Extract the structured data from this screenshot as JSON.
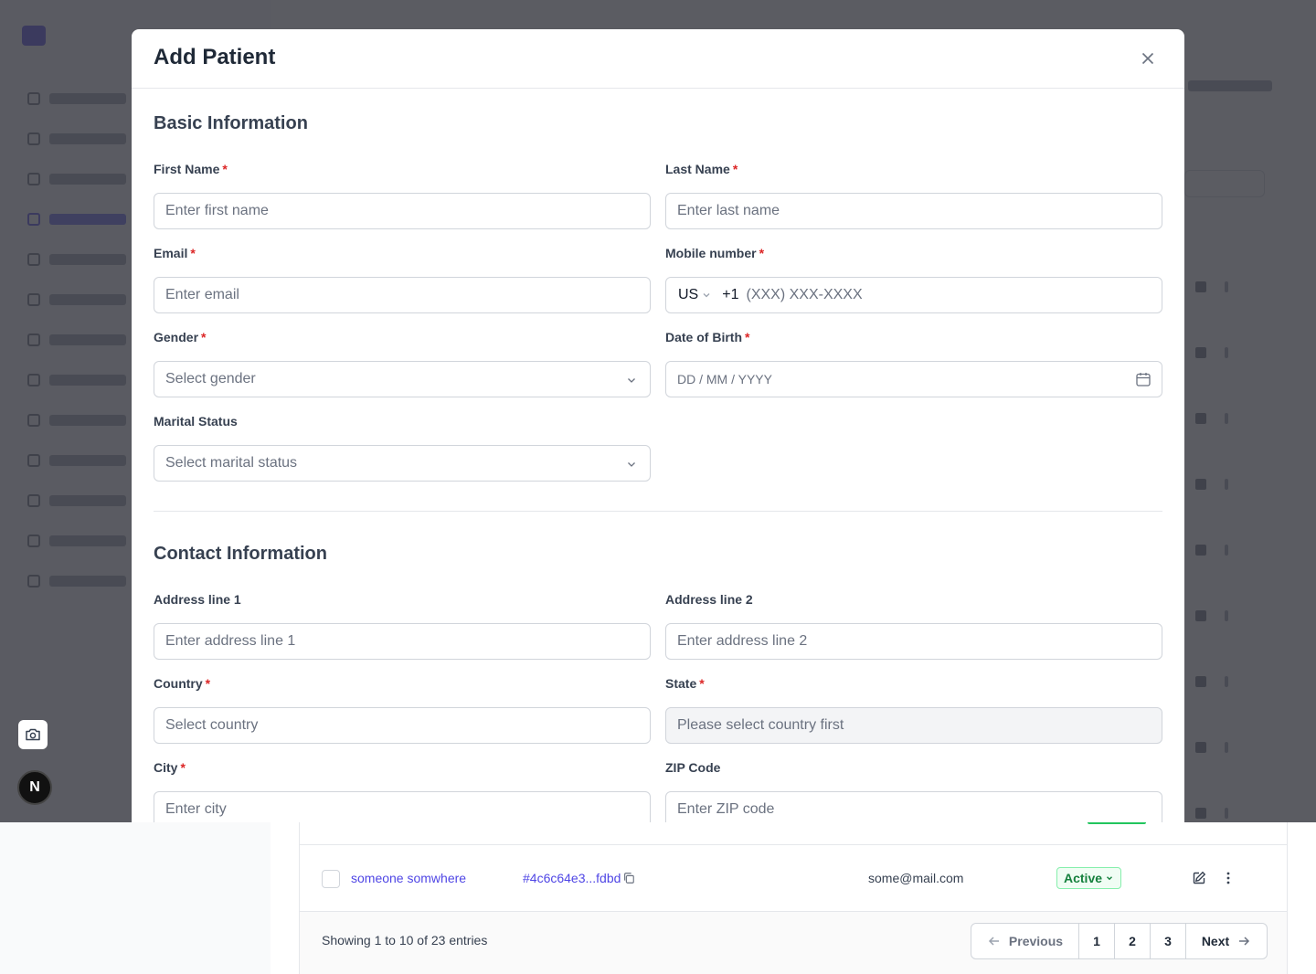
{
  "modal": {
    "title": "Add Patient",
    "sections": {
      "basic": "Basic Information",
      "contact": "Contact Information"
    },
    "fields": {
      "first_name": {
        "label": "First Name",
        "placeholder": "Enter first name",
        "required": true
      },
      "last_name": {
        "label": "Last Name",
        "placeholder": "Enter last name",
        "required": true
      },
      "email": {
        "label": "Email",
        "placeholder": "Enter email",
        "required": true
      },
      "mobile": {
        "label": "Mobile number",
        "country": "US",
        "code": "+1",
        "placeholder": "(XXX) XXX-XXXX",
        "required": true
      },
      "gender": {
        "label": "Gender",
        "placeholder": "Select gender",
        "required": true
      },
      "dob": {
        "label": "Date of Birth",
        "placeholder": "DD / MM / YYYY",
        "required": true
      },
      "marital": {
        "label": "Marital Status",
        "placeholder": "Select marital status",
        "required": false
      },
      "address1": {
        "label": "Address line 1",
        "placeholder": "Enter address line 1",
        "required": false
      },
      "address2": {
        "label": "Address line 2",
        "placeholder": "Enter address line 2",
        "required": false
      },
      "country": {
        "label": "Country",
        "placeholder": "Select country",
        "required": true
      },
      "state": {
        "label": "State",
        "placeholder": "Please select country first",
        "required": true
      },
      "city": {
        "label": "City",
        "placeholder": "Enter city",
        "required": true
      },
      "zip": {
        "label": "ZIP Code",
        "placeholder": "Enter ZIP code",
        "required": false
      }
    },
    "required_mark": "*",
    "close_icon": "close-icon"
  },
  "table": {
    "row": {
      "name": "someone somwhere",
      "id": "#4c6c64e3...fdbd",
      "email": "some@mail.com",
      "status": "Active"
    },
    "footer": {
      "entries": "Showing 1 to 10 of 23 entries",
      "previous": "Previous",
      "next": "Next",
      "pages": [
        "1",
        "2",
        "3"
      ]
    }
  },
  "floating": {
    "n_label": "N"
  },
  "colors": {
    "accent": "#4f46e5",
    "required": "#dc2626",
    "status_green": "#15803d",
    "overlay": "rgba(55, 56, 64, 0.82)"
  }
}
